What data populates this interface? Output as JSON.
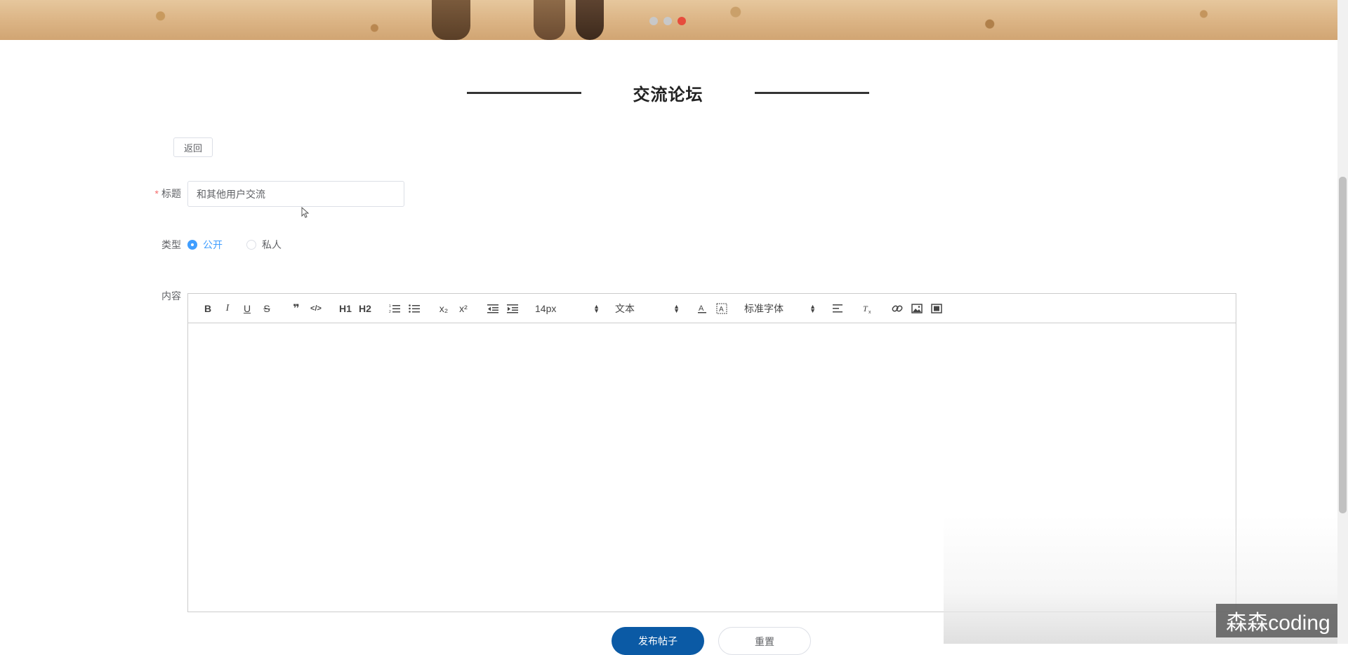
{
  "banner": {
    "carousel_dots": 3,
    "active_dot": 3,
    "active_color": "#e74c3c"
  },
  "section": {
    "title": "交流论坛"
  },
  "actions": {
    "back_label": "返回",
    "publish_label": "发布帖子",
    "reset_label": "重置"
  },
  "form": {
    "title_label": "标题",
    "title_required_mark": "*",
    "title_value": "和其他用户交流",
    "type_label": "类型",
    "type_options": [
      {
        "label": "公开",
        "selected": true
      },
      {
        "label": "私人",
        "selected": false
      }
    ],
    "content_label": "内容"
  },
  "editor": {
    "toolbar": {
      "bold": "B",
      "italic": "I",
      "underline": "U",
      "strike": "S",
      "blockquote": "❞",
      "code": "</>",
      "h1": "H1",
      "h2": "H2",
      "subscript": "x₂",
      "superscript": "x²",
      "font_size": "14px",
      "header_select": "文本",
      "font_family": "标准字体",
      "icons": [
        "bold-icon",
        "italic-icon",
        "underline-icon",
        "strike-icon",
        "blockquote-icon",
        "code-block-icon",
        "header1-icon",
        "header2-icon",
        "ordered-list-icon",
        "bullet-list-icon",
        "subscript-icon",
        "superscript-icon",
        "outdent-icon",
        "indent-icon",
        "font-color-icon",
        "background-color-icon",
        "align-icon",
        "clean-format-icon",
        "link-icon",
        "image-icon",
        "video-icon"
      ]
    }
  },
  "watermark": {
    "text": "森森coding"
  },
  "colors": {
    "primary": "#409eff",
    "publish_button": "#0b5aa5",
    "required": "#f56c6c"
  }
}
